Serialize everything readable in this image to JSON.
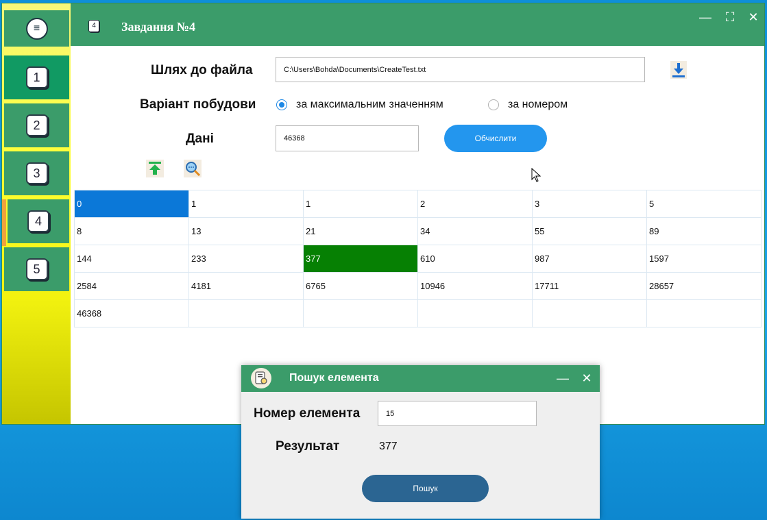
{
  "sidebar": {
    "menu_glyph": "≡",
    "items": [
      {
        "label": "1"
      },
      {
        "label": "2"
      },
      {
        "label": "3"
      },
      {
        "label": "4"
      },
      {
        "label": "5"
      }
    ]
  },
  "window": {
    "icon_label": "4",
    "title": "Завдання №4",
    "controls": {
      "minimize": "—",
      "maximize": "⛶",
      "close": "✕"
    }
  },
  "form": {
    "path_label": "Шлях до файла",
    "path_value": "C:\\Users\\Bohda\\Documents\\CreateTest.txt",
    "variant_label": "Варіант побудови",
    "radio_max": "за максимальним значенням",
    "radio_number": "за номером",
    "radio_selected": "max",
    "data_label": "Дані",
    "data_value": "46368",
    "calc_button": "Обчислити"
  },
  "grid": {
    "rows": [
      [
        "0",
        "1",
        "1",
        "2",
        "3",
        "5"
      ],
      [
        "8",
        "13",
        "21",
        "34",
        "55",
        "89"
      ],
      [
        "144",
        "233",
        "377",
        "610",
        "987",
        "1597"
      ],
      [
        "2584",
        "4181",
        "6765",
        "10946",
        "17711",
        "28657"
      ],
      [
        "46368",
        "",
        "",
        "",
        "",
        ""
      ]
    ]
  },
  "dialog": {
    "title": "Пошук елемента",
    "controls": {
      "minimize": "—",
      "close": "✕"
    },
    "number_label": "Номер елемента",
    "number_value": "15",
    "result_label": "Результат",
    "result_value": "377",
    "search_button": "Пошук"
  },
  "colors": {
    "green_bar": "#3b9c6a",
    "accent_blue": "#2396ee",
    "selected_cell_blue": "#0b78d8",
    "found_cell_green": "#068003"
  }
}
